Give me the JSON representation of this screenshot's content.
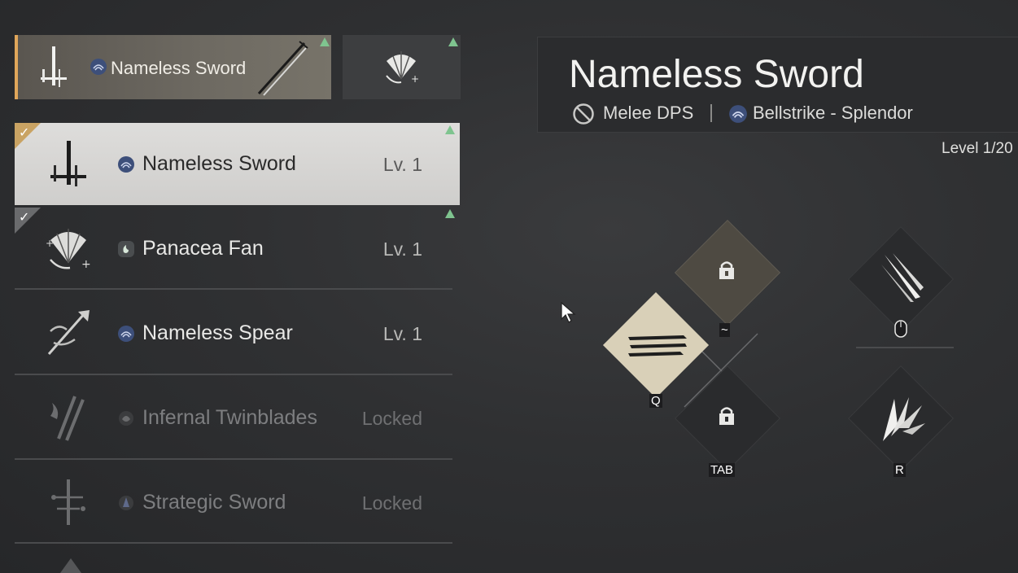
{
  "equipped": {
    "main_name": "Nameless Sword"
  },
  "weapons": [
    {
      "name": "Nameless Sword",
      "level": "Lv. 1"
    },
    {
      "name": "Panacea Fan",
      "level": "Lv. 1"
    },
    {
      "name": "Nameless Spear",
      "level": "Lv. 1"
    },
    {
      "name": "Infernal Twinblades",
      "level": "Locked"
    },
    {
      "name": "Strategic Sword",
      "level": "Locked"
    }
  ],
  "detail": {
    "title": "Nameless Sword",
    "role": "Melee DPS",
    "path": "Bellstrike - Splendor",
    "level": "Level 1/20"
  },
  "skills": {
    "key_q": "Q",
    "key_tilde": "~",
    "key_tab": "TAB",
    "key_r": "R"
  },
  "colors": {
    "accent": "#e0a65a",
    "upgrade_arrow": "#7fc48f",
    "selected_corner": "#c9a363"
  }
}
